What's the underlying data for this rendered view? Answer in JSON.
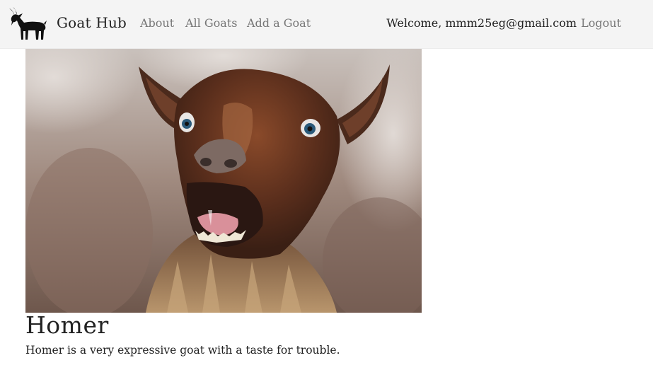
{
  "navbar": {
    "brand": "Goat Hub",
    "brand_icon": "goat-logo-icon",
    "links": [
      {
        "label": "About"
      },
      {
        "label": "All Goats"
      },
      {
        "label": "Add a Goat"
      }
    ],
    "welcome": "Welcome, mmm25eg@gmail.com",
    "logout_label": "Logout"
  },
  "goat": {
    "name": "Homer",
    "description": "Homer is a very expressive goat with a taste for trouble."
  }
}
